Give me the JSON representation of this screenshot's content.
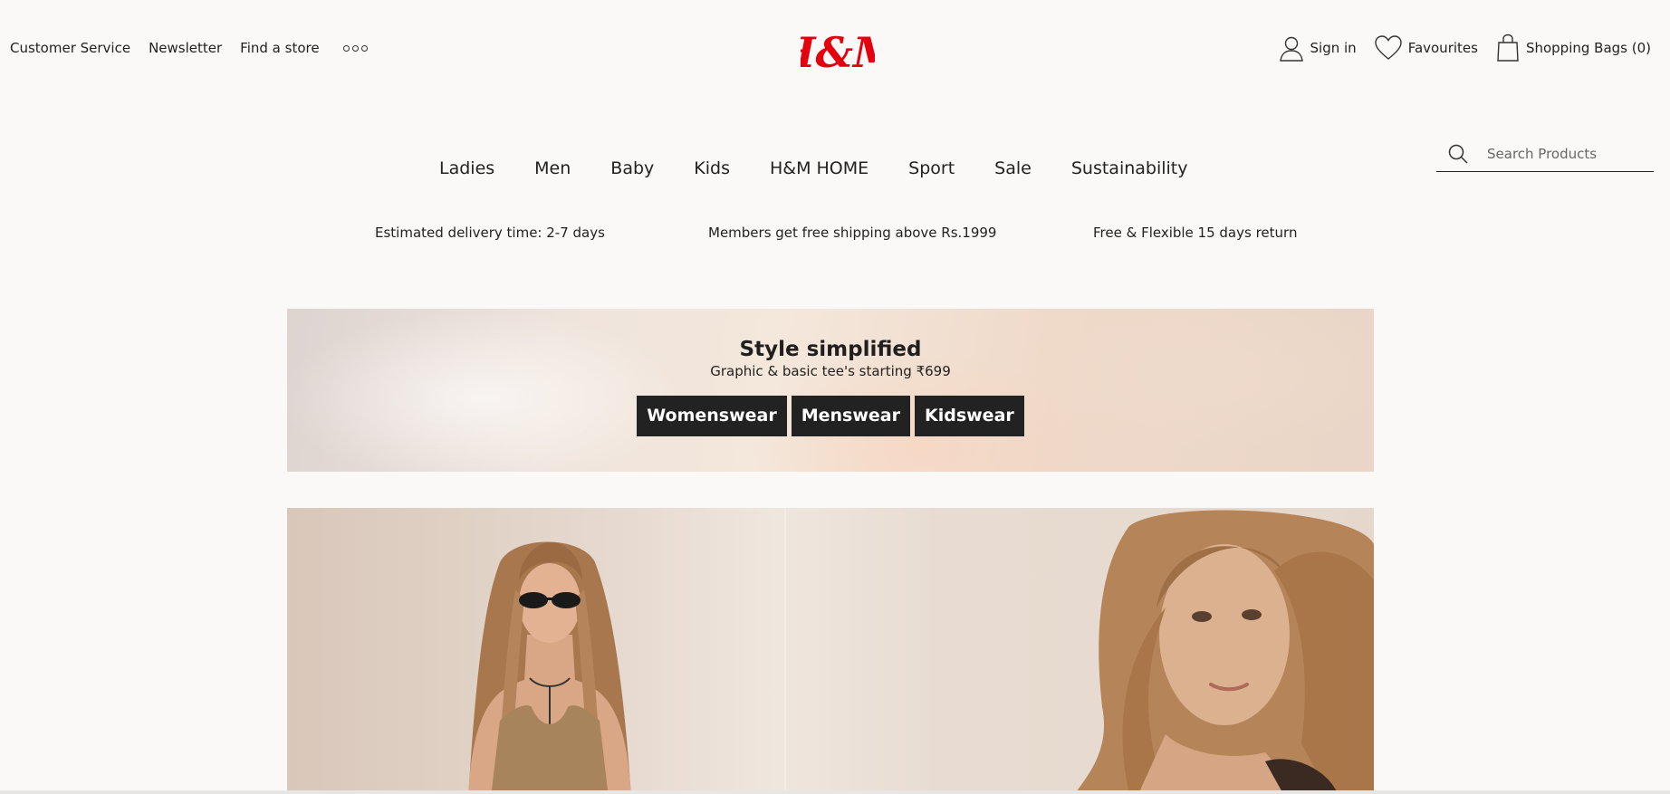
{
  "header": {
    "left_links": [
      {
        "label": "Customer Service"
      },
      {
        "label": "Newsletter"
      },
      {
        "label": "Find a store"
      }
    ],
    "more_icon": "more-icon",
    "logo_text": "H&M",
    "right_links": {
      "sign_in": "Sign in",
      "favourites": "Favourites",
      "shopping_bags": "Shopping Bags (0)"
    }
  },
  "nav": {
    "items": [
      {
        "label": "Ladies"
      },
      {
        "label": "Men"
      },
      {
        "label": "Baby"
      },
      {
        "label": "Kids"
      },
      {
        "label": "H&M HOME"
      },
      {
        "label": "Sport"
      },
      {
        "label": "Sale"
      },
      {
        "label": "Sustainability"
      }
    ]
  },
  "search": {
    "placeholder": "Search Products",
    "icon": "search-icon"
  },
  "info_strip": {
    "delivery": "Estimated delivery time: 2-7 days",
    "shipping": "Members get free shipping above Rs.1999",
    "returns": "Free & Flexible 15 days return"
  },
  "promo": {
    "title": "Style simplified",
    "subtitle": "Graphic & basic tee's starting ₹699",
    "buttons": [
      {
        "label": "Womenswear"
      },
      {
        "label": "Menswear"
      },
      {
        "label": "Kidswear"
      }
    ]
  },
  "colors": {
    "brand_red": "#e50010",
    "text": "#222222",
    "background": "#faf9f8",
    "button_bg": "#222222"
  }
}
